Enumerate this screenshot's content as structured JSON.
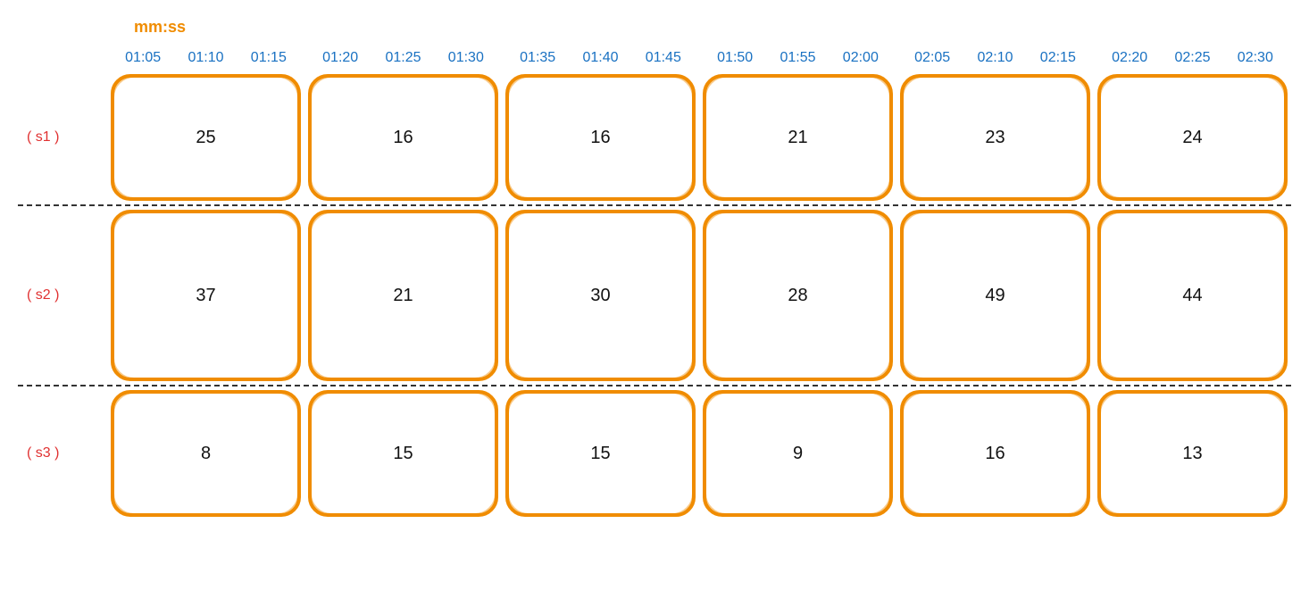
{
  "format_label": "mm:ss",
  "time_headers": [
    [
      "01:05",
      "01:10",
      "01:15"
    ],
    [
      "01:20",
      "01:25",
      "01:30"
    ],
    [
      "01:35",
      "01:40",
      "01:45"
    ],
    [
      "01:50",
      "01:55",
      "02:00"
    ],
    [
      "02:05",
      "02:10",
      "02:15"
    ],
    [
      "02:20",
      "02:25",
      "02:30"
    ]
  ],
  "rows": [
    {
      "label": "( s1 )",
      "values": [
        25,
        16,
        16,
        21,
        23,
        24
      ]
    },
    {
      "label": "( s2 )",
      "values": [
        37,
        21,
        30,
        28,
        49,
        44
      ]
    },
    {
      "label": "( s3 )",
      "values": [
        8,
        15,
        15,
        9,
        16,
        13
      ]
    }
  ],
  "chart_data": {
    "type": "heatmap",
    "title": "",
    "xlabel": "mm:ss",
    "ylabel": "",
    "x": [
      [
        "01:05",
        "01:10",
        "01:15"
      ],
      [
        "01:20",
        "01:25",
        "01:30"
      ],
      [
        "01:35",
        "01:40",
        "01:45"
      ],
      [
        "01:50",
        "01:55",
        "02:00"
      ],
      [
        "02:05",
        "02:10",
        "02:15"
      ],
      [
        "02:20",
        "02:25",
        "02:30"
      ]
    ],
    "y": [
      "s1",
      "s2",
      "s3"
    ],
    "series": [
      {
        "name": "s1",
        "values": [
          25,
          16,
          16,
          21,
          23,
          24
        ]
      },
      {
        "name": "s2",
        "values": [
          37,
          21,
          30,
          28,
          49,
          44
        ]
      },
      {
        "name": "s3",
        "values": [
          8,
          15,
          15,
          9,
          16,
          13
        ]
      }
    ]
  }
}
